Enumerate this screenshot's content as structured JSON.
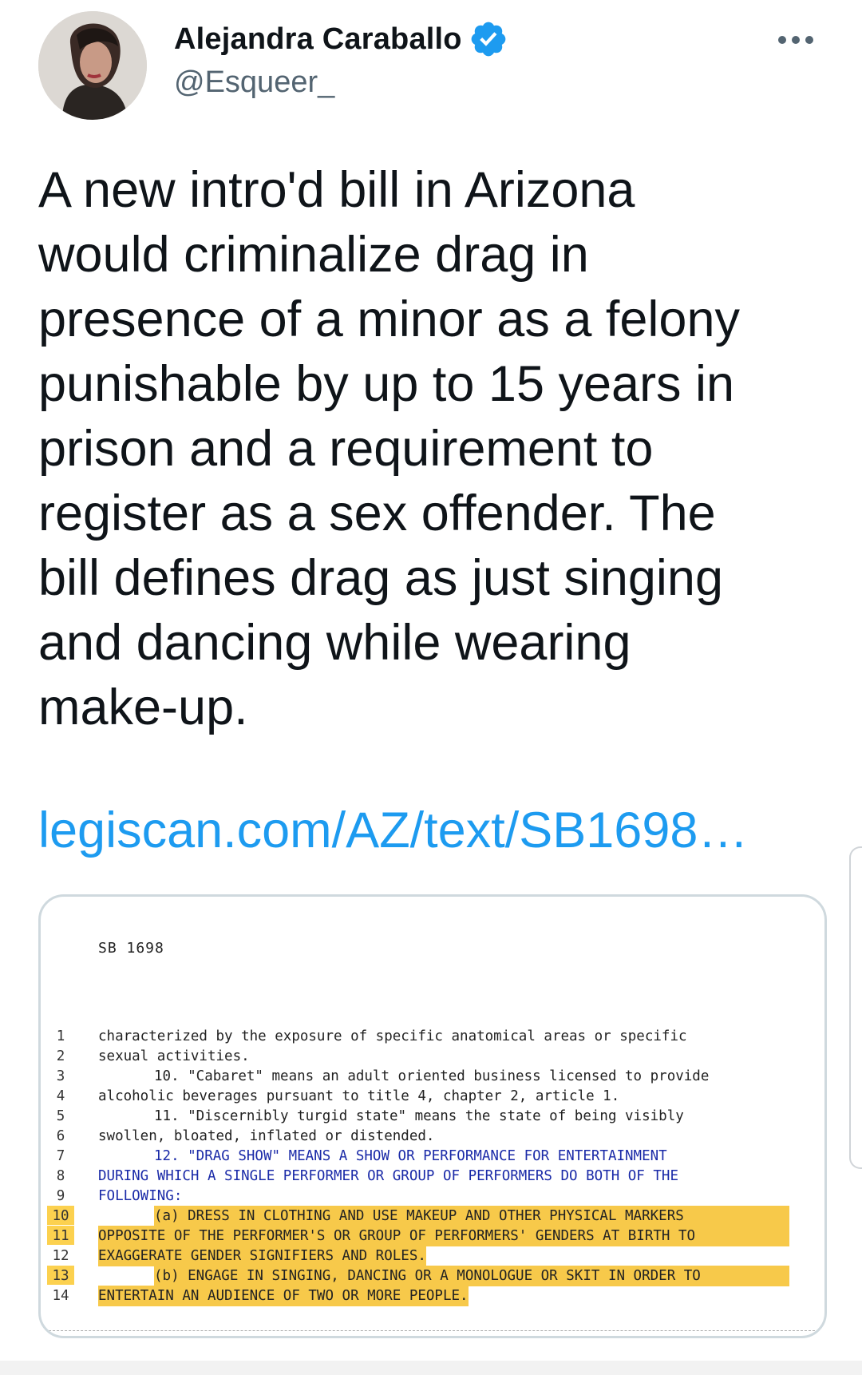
{
  "author": {
    "name": "Alejandra Caraballo",
    "handle": "@Esqueer_",
    "verified": true,
    "verified_color": "#1d9bf0",
    "avatar_icon": "user-avatar-photo"
  },
  "tweet": {
    "text": "A new intro'd bill in Arizona\nwould criminalize drag in\npresence of a minor as a felony\npunishable by up to 15 years in\nprison and a requirement to\nregister as a sex offender. The\nbill defines drag as just singing\nand dancing while wearing\nmake-up.",
    "link": "legiscan.com/AZ/text/SB1698…",
    "link_color": "#1d9bf0"
  },
  "document": {
    "title": "SB 1698",
    "highlight_color": "#f7c94a",
    "lines": [
      {
        "n": "1",
        "t": "characterized by the exposure of specific anatomical areas or specific"
      },
      {
        "n": "2",
        "t": "sexual activities."
      },
      {
        "n": "3",
        "t": "10.  \"Cabaret\" means an adult oriented business licensed to provide"
      },
      {
        "n": "4",
        "t": "alcoholic beverages pursuant to title 4, chapter 2, article 1."
      },
      {
        "n": "5",
        "t": "11.  \"Discernibly turgid state\" means the state of being visibly"
      },
      {
        "n": "6",
        "t": "swollen, bloated, inflated or distended."
      },
      {
        "n": "7",
        "t": "12.  \"DRAG SHOW\" MEANS A SHOW OR PERFORMANCE FOR ENTERTAINMENT"
      },
      {
        "n": "8",
        "t": "DURING WHICH A SINGLE PERFORMER OR GROUP OF PERFORMERS DO BOTH OF THE"
      },
      {
        "n": "9",
        "t": "FOLLOWING:"
      },
      {
        "n": "10",
        "t": "(a)  DRESS IN CLOTHING AND USE MAKEUP AND OTHER PHYSICAL MARKERS"
      },
      {
        "n": "11",
        "t": "OPPOSITE OF THE PERFORMER'S OR GROUP OF PERFORMERS' GENDERS AT BIRTH TO"
      },
      {
        "n": "12",
        "t": "EXAGGERATE GENDER SIGNIFIERS AND ROLES."
      },
      {
        "n": "13",
        "t": "(b)  ENGAGE IN SINGING, DANCING OR A MONOLOGUE OR SKIT IN ORDER TO"
      },
      {
        "n": "14",
        "t": "ENTERTAIN AN AUDIENCE OF TWO OR MORE PEOPLE."
      }
    ]
  }
}
